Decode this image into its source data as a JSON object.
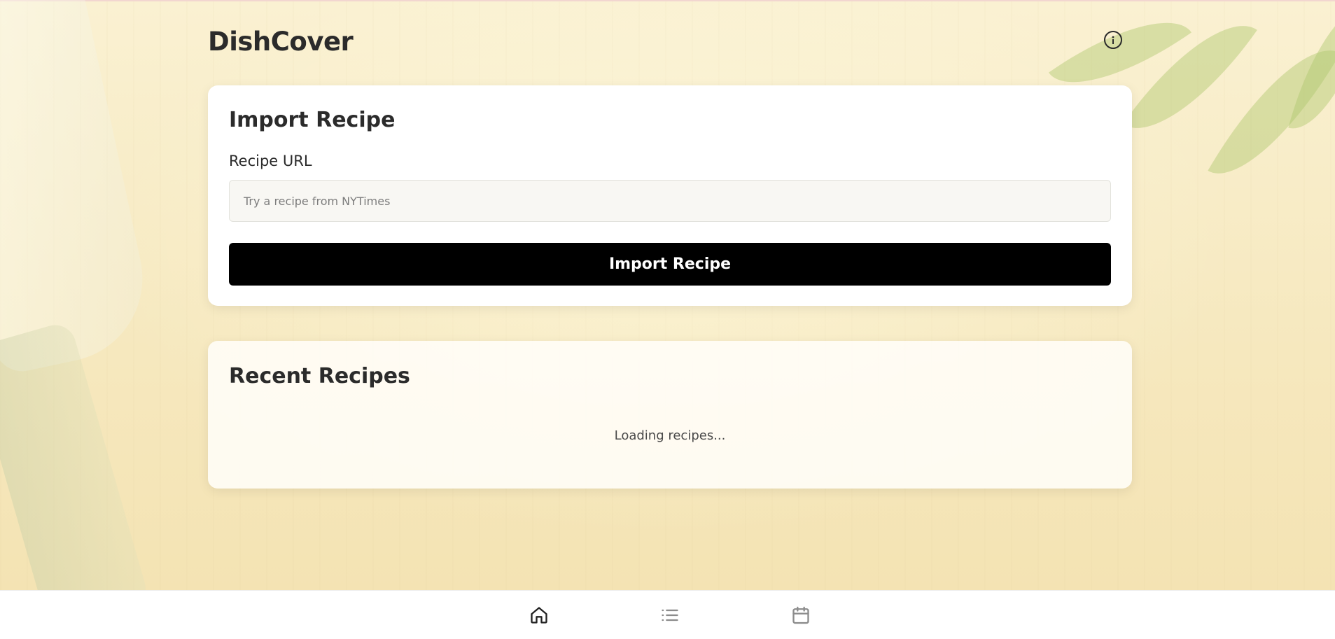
{
  "app": {
    "name": "DishCover"
  },
  "header": {
    "info_icon": "info-icon"
  },
  "import_card": {
    "title": "Import Recipe",
    "url_label": "Recipe URL",
    "url_value": "",
    "url_placeholder": "Try a recipe from NYTimes",
    "button_label": "Import Recipe"
  },
  "recent_card": {
    "title": "Recent Recipes",
    "status": "Loading recipes..."
  },
  "bottom_nav": {
    "items": [
      {
        "icon": "home-icon",
        "active": true
      },
      {
        "icon": "list-icon",
        "active": false
      },
      {
        "icon": "calendar-icon",
        "active": false
      }
    ]
  },
  "colors": {
    "primary_button": "#000000",
    "text": "#2b2b2b",
    "nav_active": "#222222",
    "nav_inactive": "#8c8c8c"
  }
}
